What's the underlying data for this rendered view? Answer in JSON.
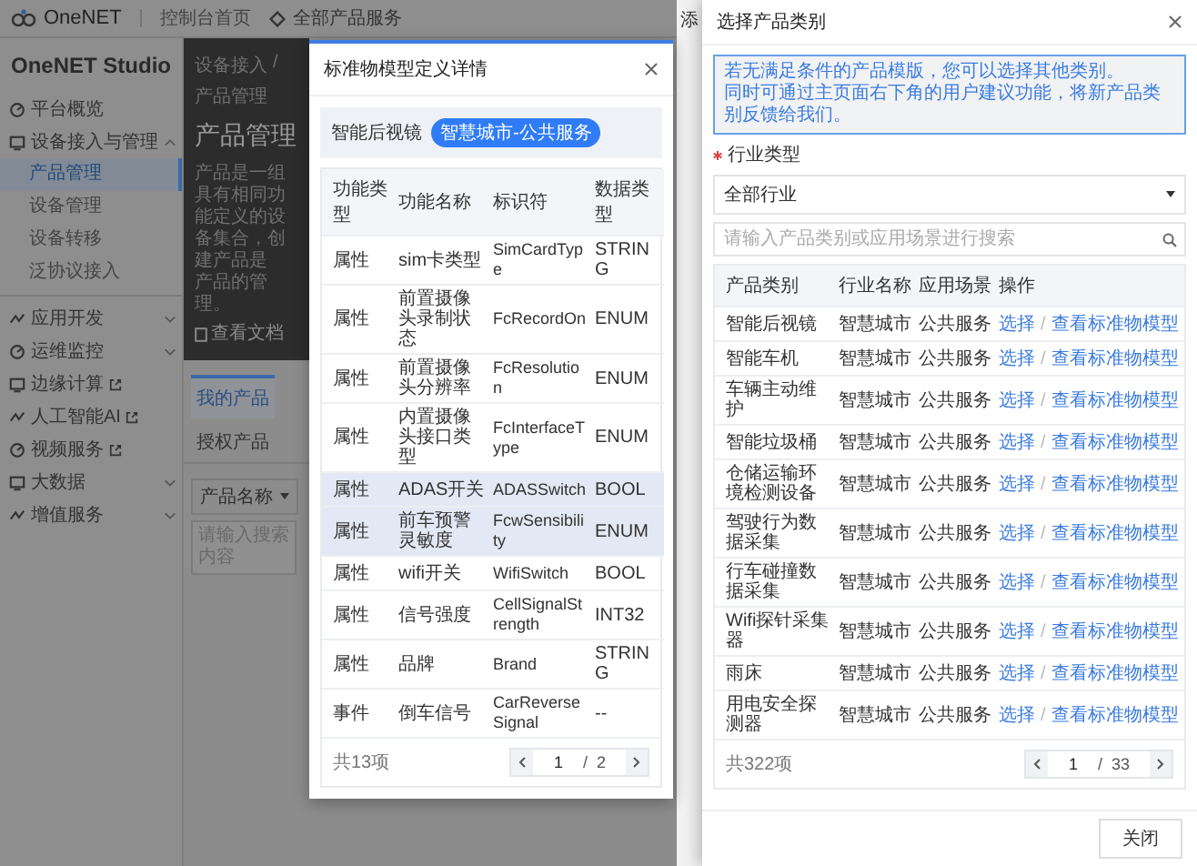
{
  "header": {
    "logo": "OneNET",
    "home_link": "控制台首页",
    "services_menu": "全部产品服务"
  },
  "sidebar": {
    "title": "OneNET Studio",
    "items": [
      {
        "label": "平台概览",
        "kind": "plain"
      },
      {
        "label": "设备接入与管理",
        "kind": "group",
        "expanded": true,
        "children": [
          {
            "label": "产品管理",
            "selected": true
          },
          {
            "label": "设备管理",
            "selected": false
          },
          {
            "label": "设备转移",
            "selected": false
          },
          {
            "label": "泛协议接入",
            "selected": false
          }
        ]
      },
      {
        "label": "应用开发",
        "kind": "group",
        "expanded": false
      },
      {
        "label": "运维监控",
        "kind": "group",
        "expanded": false
      },
      {
        "label": "边缘计算",
        "kind": "external"
      },
      {
        "label": "人工智能AI",
        "kind": "external"
      },
      {
        "label": "视频服务",
        "kind": "external"
      },
      {
        "label": "大数据",
        "kind": "group",
        "expanded": false
      },
      {
        "label": "增值服务",
        "kind": "group",
        "expanded": false
      }
    ]
  },
  "main": {
    "breadcrumb": [
      "设备接入",
      "产品管理"
    ],
    "breadcrumb_separator": "/",
    "title": "产品管理",
    "description": "产品是一组具有相同功能定义的设备集合，创建产品是",
    "description_2": "产品的管理。",
    "doc_link": "查看文档",
    "tabs": [
      {
        "label": "我的产品",
        "selected": true
      },
      {
        "label": "授权产品",
        "selected": false
      }
    ],
    "filter": {
      "field": "产品名称",
      "placeholder": "请输入搜索内容"
    }
  },
  "back_drawer": {
    "title": "添"
  },
  "modal": {
    "title": "标准物模型定义详情",
    "product": "智能后视镜",
    "tag": "智慧城市-公共服务",
    "columns": [
      "功能类型",
      "功能名称",
      "标识符",
      "数据类型"
    ],
    "rows": [
      {
        "type": "属性",
        "name": "sim卡类型",
        "identifier": "SimCardType",
        "data_type": "STRING",
        "highlighted": false
      },
      {
        "type": "属性",
        "name": "前置摄像头录制状态",
        "identifier": "FcRecordOn",
        "data_type": "ENUM",
        "highlighted": false
      },
      {
        "type": "属性",
        "name": "前置摄像头分辨率",
        "identifier": "FcResolution",
        "data_type": "ENUM",
        "highlighted": false
      },
      {
        "type": "属性",
        "name": "内置摄像头接口类型",
        "identifier": "FcInterfaceType",
        "data_type": "ENUM",
        "highlighted": false
      },
      {
        "type": "属性",
        "name": "ADAS开关",
        "identifier": "ADASSwitch",
        "data_type": "BOOL",
        "highlighted": true
      },
      {
        "type": "属性",
        "name": "前车预警灵敏度",
        "identifier": "FcwSensibility",
        "data_type": "ENUM",
        "highlighted": true
      },
      {
        "type": "属性",
        "name": "wifi开关",
        "identifier": "WifiSwitch",
        "data_type": "BOOL",
        "highlighted": false
      },
      {
        "type": "属性",
        "name": "信号强度",
        "identifier": "CellSignalStrength",
        "data_type": "INT32",
        "highlighted": false
      },
      {
        "type": "属性",
        "name": "品牌",
        "identifier": "Brand",
        "data_type": "STRING",
        "highlighted": false
      },
      {
        "type": "事件",
        "name": "倒车信号",
        "identifier": "CarReverseSignal",
        "data_type": "--",
        "highlighted": false
      }
    ],
    "total": "共13项",
    "pager": {
      "page": "1",
      "separator": "/",
      "pages": "2"
    }
  },
  "drawer": {
    "title": "选择产品类别",
    "notice": [
      "若无满足条件的产品模版，您可以选择其他类别。",
      "同时可通过主页面右下角的用户建议功能，将新产品类别反馈给我们。"
    ],
    "industry_label": "行业类型",
    "industry_required": true,
    "industry_value": "全部行业",
    "search_placeholder": "请输入产品类别或应用场景进行搜索",
    "columns": [
      "产品类别",
      "行业名称",
      "应用场景",
      "操作"
    ],
    "rows": [
      {
        "category": "智能后视镜",
        "industry": "智慧城市",
        "scene": "公共服务",
        "select": "选择",
        "separator": "/",
        "view": "查看标准物模型"
      },
      {
        "category": "智能车机",
        "industry": "智慧城市",
        "scene": "公共服务",
        "select": "选择",
        "separator": "/",
        "view": "查看标准物模型"
      },
      {
        "category": "车辆主动维护",
        "industry": "智慧城市",
        "scene": "公共服务",
        "select": "选择",
        "separator": "/",
        "view": "查看标准物模型"
      },
      {
        "category": "智能垃圾桶",
        "industry": "智慧城市",
        "scene": "公共服务",
        "select": "选择",
        "separator": "/",
        "view": "查看标准物模型"
      },
      {
        "category": "仓储运输环境检测设备",
        "industry": "智慧城市",
        "scene": "公共服务",
        "select": "选择",
        "separator": "/",
        "view": "查看标准物模型"
      },
      {
        "category": "驾驶行为数据采集",
        "industry": "智慧城市",
        "scene": "公共服务",
        "select": "选择",
        "separator": "/",
        "view": "查看标准物模型"
      },
      {
        "category": "行车碰撞数据采集",
        "industry": "智慧城市",
        "scene": "公共服务",
        "select": "选择",
        "separator": "/",
        "view": "查看标准物模型"
      },
      {
        "category": "Wifi探针采集器",
        "industry": "智慧城市",
        "scene": "公共服务",
        "select": "选择",
        "separator": "/",
        "view": "查看标准物模型"
      },
      {
        "category": "雨床",
        "industry": "智慧城市",
        "scene": "公共服务",
        "select": "选择",
        "separator": "/",
        "view": "查看标准物模型"
      },
      {
        "category": "用电安全探测器",
        "industry": "智慧城市",
        "scene": "公共服务",
        "select": "选择",
        "separator": "/",
        "view": "查看标准物模型"
      }
    ],
    "total": "共322项",
    "pager": {
      "page": "1",
      "separator": "/",
      "pages": "33"
    },
    "close_button": "关闭"
  }
}
